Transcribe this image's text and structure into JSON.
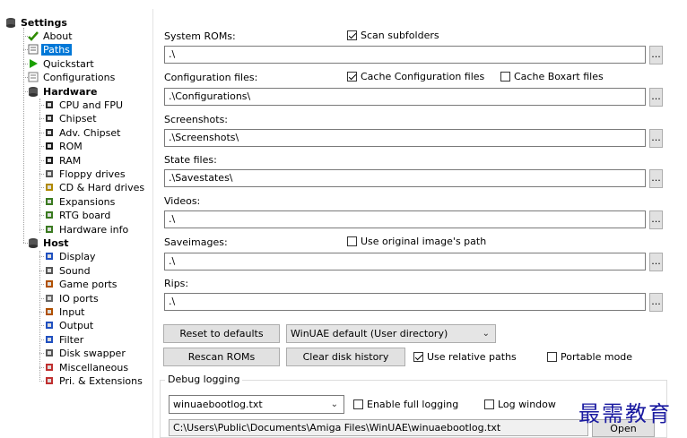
{
  "tree": {
    "root": "Settings",
    "items": [
      {
        "label": "About",
        "icon": "about-check-icon",
        "level": 1
      },
      {
        "label": "Paths",
        "icon": "paths-folder-icon",
        "level": 1,
        "selected": true
      },
      {
        "label": "Quickstart",
        "icon": "quickstart-play-icon",
        "level": 1
      },
      {
        "label": "Configurations",
        "icon": "configurations-icon",
        "level": 1
      },
      {
        "label": "Hardware",
        "icon": "hardware-icon",
        "level": 1,
        "bold": true
      },
      {
        "label": "CPU and FPU",
        "icon": "chip-icon",
        "level": 2
      },
      {
        "label": "Chipset",
        "icon": "chip-icon",
        "level": 2
      },
      {
        "label": "Adv. Chipset",
        "icon": "chip-icon",
        "level": 2
      },
      {
        "label": "ROM",
        "icon": "rom-chip-icon",
        "level": 2
      },
      {
        "label": "RAM",
        "icon": "ram-chip-icon",
        "level": 2
      },
      {
        "label": "Floppy drives",
        "icon": "floppy-drive-icon",
        "level": 2
      },
      {
        "label": "CD & Hard drives",
        "icon": "hard-drive-icon",
        "level": 2
      },
      {
        "label": "Expansions",
        "icon": "expansion-card-icon",
        "level": 2
      },
      {
        "label": "RTG board",
        "icon": "rtg-board-icon",
        "level": 2
      },
      {
        "label": "Hardware info",
        "icon": "hardware-info-icon",
        "level": 2
      },
      {
        "label": "Host",
        "icon": "host-icon",
        "level": 1,
        "bold": true
      },
      {
        "label": "Display",
        "icon": "display-monitor-icon",
        "level": 2
      },
      {
        "label": "Sound",
        "icon": "sound-icon",
        "level": 2
      },
      {
        "label": "Game ports",
        "icon": "joystick-icon",
        "level": 2
      },
      {
        "label": "IO ports",
        "icon": "io-ports-icon",
        "level": 2
      },
      {
        "label": "Input",
        "icon": "input-joystick-icon",
        "level": 2
      },
      {
        "label": "Output",
        "icon": "output-icon",
        "level": 2
      },
      {
        "label": "Filter",
        "icon": "filter-monitor-icon",
        "level": 2
      },
      {
        "label": "Disk swapper",
        "icon": "disk-swapper-icon",
        "level": 2
      },
      {
        "label": "Miscellaneous",
        "icon": "miscellaneous-icon",
        "level": 2
      },
      {
        "label": "Pri. & Extensions",
        "icon": "extensions-icon",
        "level": 2
      }
    ]
  },
  "paths": {
    "system_roms": {
      "label": "System ROMs:",
      "value": ".\\",
      "browse": "..."
    },
    "scan_subfolders": {
      "label": "Scan subfolders",
      "checked": true
    },
    "config_files": {
      "label": "Configuration files:",
      "value": ".\\Configurations\\",
      "browse": "..."
    },
    "cache_config": {
      "label": "Cache Configuration files",
      "checked": true
    },
    "cache_boxart": {
      "label": "Cache Boxart files",
      "checked": false
    },
    "screenshots": {
      "label": "Screenshots:",
      "value": ".\\Screenshots\\",
      "browse": "..."
    },
    "state_files": {
      "label": "State files:",
      "value": ".\\Savestates\\",
      "browse": "..."
    },
    "videos": {
      "label": "Videos:",
      "value": ".\\",
      "browse": "..."
    },
    "saveimages": {
      "label": "Saveimages:",
      "value": ".\\",
      "browse": "..."
    },
    "use_original_path": {
      "label": "Use original image's path",
      "checked": false
    },
    "rips": {
      "label": "Rips:",
      "value": ".\\",
      "browse": "..."
    }
  },
  "actions": {
    "reset_defaults": "Reset to defaults",
    "path_mode": "WinUAE default (User directory)",
    "rescan_roms": "Rescan ROMs",
    "clear_disk_history": "Clear disk history",
    "use_relative_paths": {
      "label": "Use relative paths",
      "checked": true
    },
    "portable_mode": {
      "label": "Portable mode",
      "checked": false
    }
  },
  "debug": {
    "title": "Debug logging",
    "log_file": "winuaebootlog.txt",
    "enable_full_logging": {
      "label": "Enable full logging",
      "checked": false
    },
    "log_window": {
      "label": "Log window",
      "checked": false
    },
    "log_path": "C:\\Users\\Public\\Documents\\Amiga Files\\WinUAE\\winuaebootlog.txt",
    "open_button": "Open"
  },
  "watermark": "最需教育",
  "colors": {
    "selection": "#0078d7",
    "button_face": "#e1e1e1",
    "watermark": "#1a1aa0"
  }
}
